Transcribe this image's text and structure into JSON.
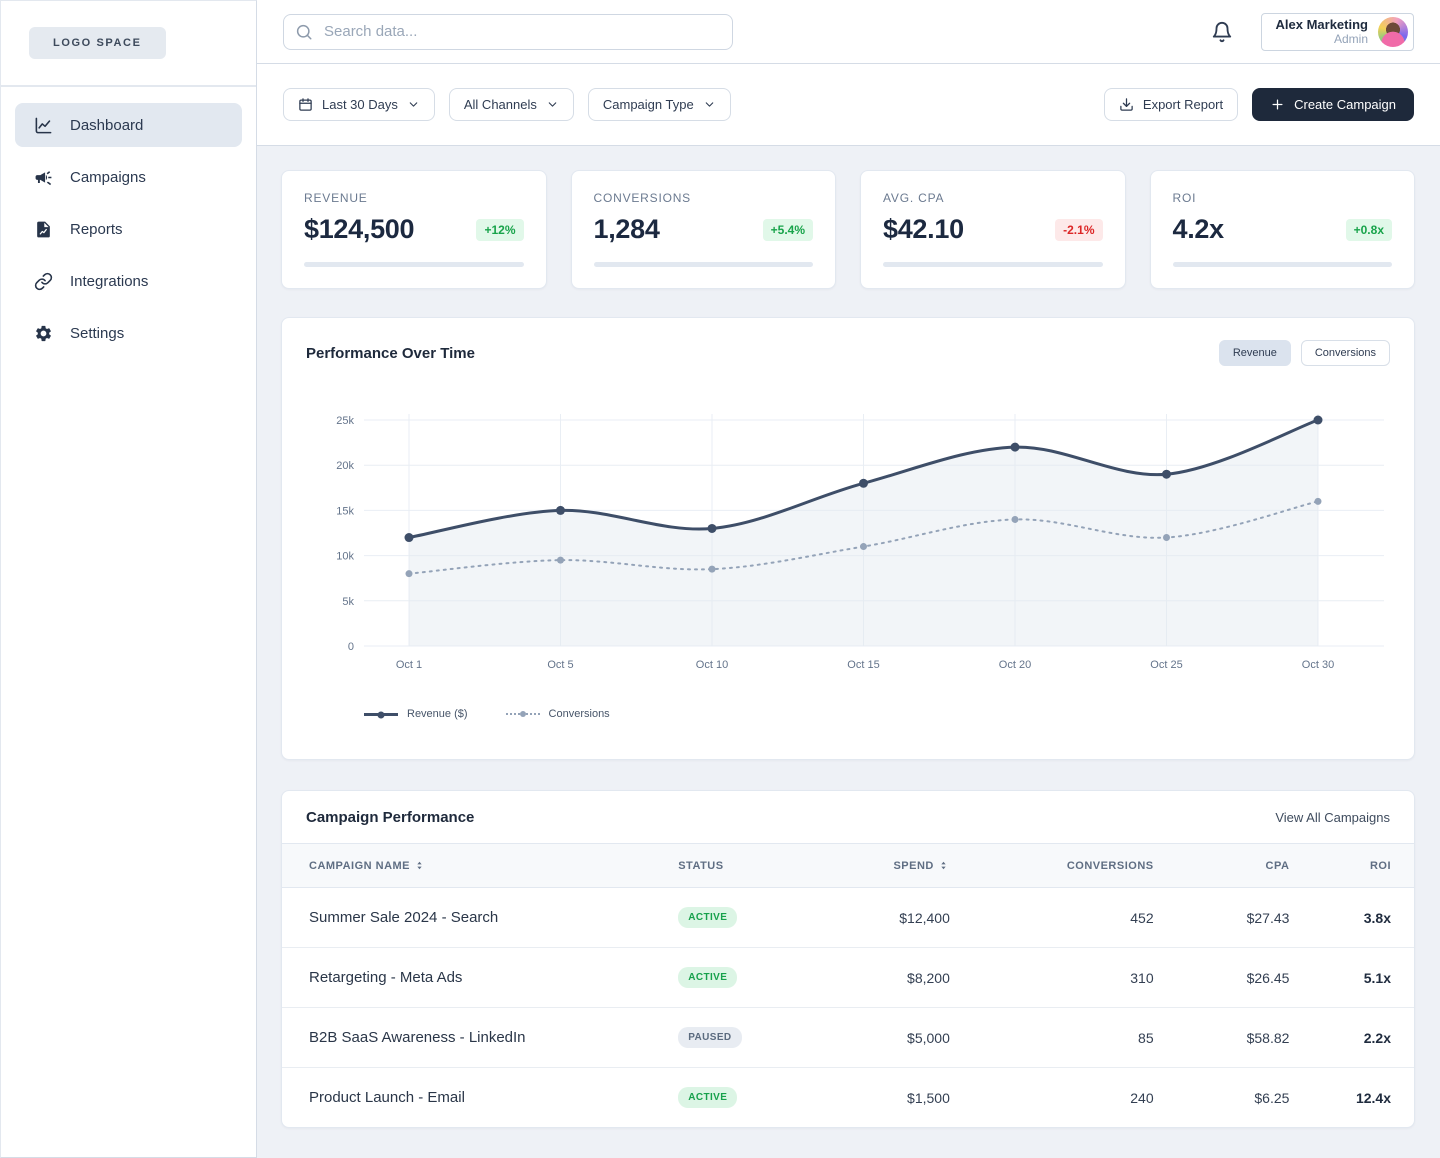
{
  "sidebar": {
    "logo": "LOGO SPACE",
    "items": [
      {
        "label": "Dashboard",
        "icon": "chart-line-icon",
        "active": true
      },
      {
        "label": "Campaigns",
        "icon": "megaphone-icon",
        "active": false
      },
      {
        "label": "Reports",
        "icon": "report-file-icon",
        "active": false
      },
      {
        "label": "Integrations",
        "icon": "link-icon",
        "active": false
      },
      {
        "label": "Settings",
        "icon": "gear-icon",
        "active": false
      }
    ]
  },
  "topbar": {
    "search_placeholder": "Search data...",
    "bell_icon": "bell-icon",
    "user": {
      "name": "Alex Marketing",
      "role": "Admin"
    }
  },
  "filters": {
    "date_range": "Last 30 Days",
    "channels": "All Channels",
    "campaign_type": "Campaign Type",
    "export_label": "Export Report",
    "create_label": "Create Campaign"
  },
  "kpis": [
    {
      "label": "REVENUE",
      "value": "$124,500",
      "delta": "+12%",
      "trend": "up"
    },
    {
      "label": "CONVERSIONS",
      "value": "1,284",
      "delta": "+5.4%",
      "trend": "up"
    },
    {
      "label": "AVG. CPA",
      "value": "$42.10",
      "delta": "-2.1%",
      "trend": "down"
    },
    {
      "label": "ROI",
      "value": "4.2x",
      "delta": "+0.8x",
      "trend": "up"
    }
  ],
  "chart": {
    "title": "Performance Over Time",
    "toggle": {
      "revenue": "Revenue",
      "conversions": "Conversions",
      "active": "Revenue"
    }
  },
  "chart_data": {
    "type": "line",
    "title": "Performance Over Time",
    "x": [
      "Oct 1",
      "Oct 5",
      "Oct 10",
      "Oct 15",
      "Oct 20",
      "Oct 25",
      "Oct 30"
    ],
    "series": [
      {
        "name": "Revenue ($)",
        "style": "solid",
        "color": "#3e4e68",
        "fill": true,
        "values": [
          12000,
          15000,
          13000,
          18000,
          22000,
          19000,
          25000
        ]
      },
      {
        "name": "Conversions",
        "style": "dotted",
        "color": "#94a3b8",
        "fill": false,
        "values": [
          8000,
          9500,
          8500,
          11000,
          14000,
          12000,
          16000
        ]
      }
    ],
    "ylim": [
      0,
      25000
    ],
    "yticks": [
      "0",
      "5k",
      "10k",
      "15k",
      "20k",
      "25k"
    ],
    "grid": true,
    "legend_position": "bottom-left"
  },
  "table": {
    "title": "Campaign Performance",
    "view_all": "View All Campaigns",
    "columns": [
      {
        "label": "CAMPAIGN NAME",
        "sortable": true,
        "align": "left"
      },
      {
        "label": "STATUS",
        "sortable": false,
        "align": "left"
      },
      {
        "label": "SPEND",
        "sortable": true,
        "align": "right"
      },
      {
        "label": "CONVERSIONS",
        "sortable": false,
        "align": "right"
      },
      {
        "label": "CPA",
        "sortable": false,
        "align": "right"
      },
      {
        "label": "ROI",
        "sortable": false,
        "align": "right"
      }
    ],
    "rows": [
      {
        "name": "Summer Sale 2024 - Search",
        "status": "ACTIVE",
        "spend": "$12,400",
        "conversions": "452",
        "cpa": "$27.43",
        "roi": "3.8x"
      },
      {
        "name": "Retargeting - Meta Ads",
        "status": "ACTIVE",
        "spend": "$8,200",
        "conversions": "310",
        "cpa": "$26.45",
        "roi": "5.1x"
      },
      {
        "name": "B2B SaaS Awareness - LinkedIn",
        "status": "PAUSED",
        "spend": "$5,000",
        "conversions": "85",
        "cpa": "$58.82",
        "roi": "2.2x"
      },
      {
        "name": "Product Launch - Email",
        "status": "ACTIVE",
        "spend": "$1,500",
        "conversions": "240",
        "cpa": "$6.25",
        "roi": "12.4x"
      }
    ]
  },
  "colors": {
    "accent_dark": "#1e293b",
    "positive": "#18a34a",
    "positive_bg": "#e1f8e9",
    "negative": "#dc2626",
    "negative_bg": "#fde9e9",
    "revenue_line": "#3e4e68",
    "conversions_line": "#94a3b8",
    "active_badge_bg": "#dcf5e5",
    "paused_badge_bg": "#e8ecf2",
    "page_bg": "#eef1f6"
  }
}
